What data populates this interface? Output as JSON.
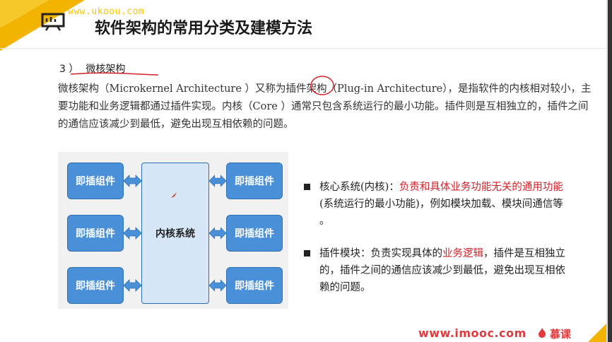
{
  "header": {
    "watermark": "www.ukoou.com",
    "title": "软件架构的常用分类及建模方法"
  },
  "section": {
    "number": "3 ）",
    "title": "微核架构"
  },
  "paragraph": "微核架构（Microkernel Architecture ）又称为插件架构（Plug-in Architecture），是指软件的内核相对较小，主要功能和业务逻辑都通过插件实现。内核（Core ）通常只包含系统运行的最小功能。插件则是互相独立的，插件之间的通信应该减少到最低，避免出现互相依赖的问题。",
  "diagram": {
    "core_label": "内核系统",
    "plugins": [
      "即插组件",
      "即插组件",
      "即插组件",
      "即插组件",
      "即插组件",
      "即插组件"
    ]
  },
  "bullets": [
    {
      "lead": "核心系统(内核)：",
      "highlight": "负责和具体业务功能无关的通用功能",
      "rest": "(系统运行的最小功能)，例如模块加载、模块间通信等 。"
    },
    {
      "lead": "插件模块：负责实现具体的",
      "highlight": "业务逻辑",
      "rest": "，插件是互相独立的，插件之间的通信应该减少到最低，避免出现互相依赖的问题。"
    }
  ],
  "footer": {
    "url": "www.imooc.com",
    "brand": "慕课"
  },
  "colors": {
    "accent_yellow": "#f2b400",
    "plugin_blue": "#4a90d9",
    "core_fill": "#d6e6f7",
    "highlight_red": "#d3222a",
    "footer_red": "#e4393c"
  },
  "icons": [
    "presentation-icon",
    "flame-icon"
  ]
}
